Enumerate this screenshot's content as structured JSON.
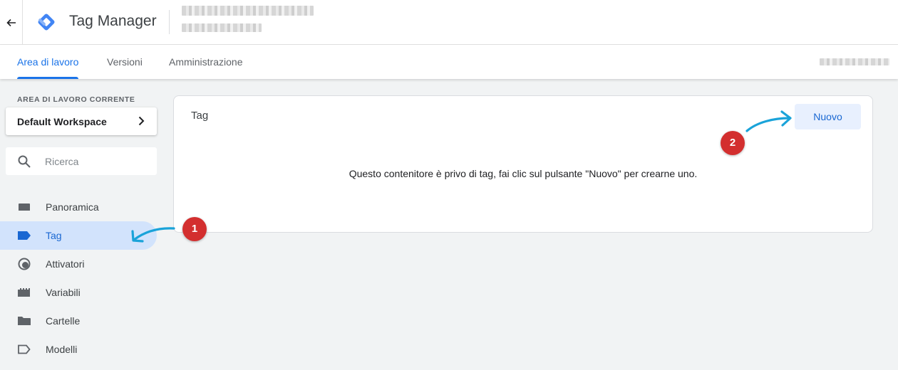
{
  "header": {
    "back_icon": "arrow-left-icon",
    "logo_icon": "tag-manager-logo",
    "app_title": "Tag Manager"
  },
  "tabs": [
    {
      "label": "Area di lavoro",
      "active": true
    },
    {
      "label": "Versioni",
      "active": false
    },
    {
      "label": "Amministrazione",
      "active": false
    }
  ],
  "sidebar": {
    "workspace_label": "AREA DI LAVORO CORRENTE",
    "workspace_name": "Default Workspace",
    "search_placeholder": "Ricerca",
    "items": [
      {
        "label": "Panoramica",
        "icon": "overview-icon",
        "active": false
      },
      {
        "label": "Tag",
        "icon": "tag-icon",
        "active": true
      },
      {
        "label": "Attivatori",
        "icon": "trigger-icon",
        "active": false
      },
      {
        "label": "Variabili",
        "icon": "variables-icon",
        "active": false
      },
      {
        "label": "Cartelle",
        "icon": "folder-icon",
        "active": false
      },
      {
        "label": "Modelli",
        "icon": "template-icon",
        "active": false
      }
    ]
  },
  "main": {
    "card_title": "Tag",
    "new_button": "Nuovo",
    "empty_message": "Questo contenitore è privo di tag, fai clic sul pulsante \"Nuovo\" per crearne uno."
  },
  "annotations": [
    {
      "number": "1"
    },
    {
      "number": "2"
    }
  ],
  "colors": {
    "accent": "#1a73e8",
    "active_bg": "#d2e3fc",
    "button_bg": "#e8f0fe",
    "badge": "#d32f2f",
    "arrow": "#1aa3d9"
  }
}
